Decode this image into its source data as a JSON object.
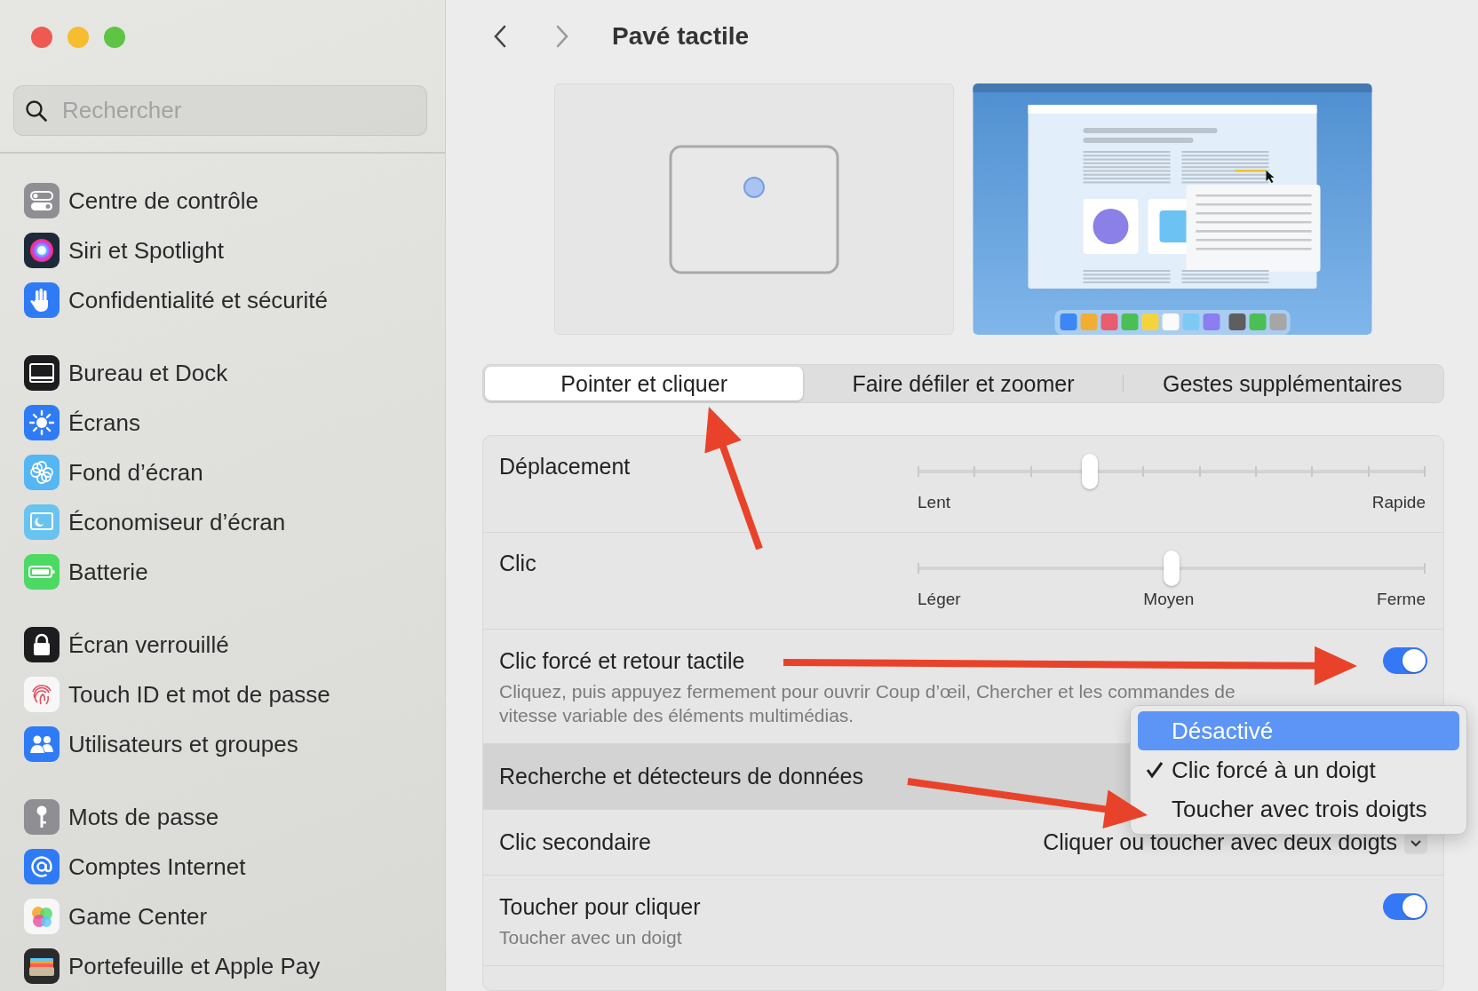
{
  "window": {
    "title": "Pavé tactile"
  },
  "sidebar": {
    "search": {
      "placeholder": "Rechercher"
    },
    "groups": [
      {
        "items": [
          {
            "kind": "controls",
            "label": "Centre de contrôle"
          },
          {
            "kind": "siri",
            "label": "Siri et Spotlight"
          },
          {
            "kind": "privacy",
            "label": "Confidentialité et sécurité"
          }
        ]
      },
      {
        "items": [
          {
            "kind": "dock",
            "label": "Bureau et Dock"
          },
          {
            "kind": "displays",
            "label": "Écrans"
          },
          {
            "kind": "wallpaper",
            "label": "Fond d’écran"
          },
          {
            "kind": "screensaver",
            "label": "Économiseur d’écran"
          },
          {
            "kind": "battery",
            "label": "Batterie"
          }
        ]
      },
      {
        "items": [
          {
            "kind": "lock",
            "label": "Écran verrouillé"
          },
          {
            "kind": "touchid",
            "label": "Touch ID et mot de passe"
          },
          {
            "kind": "users",
            "label": "Utilisateurs et groupes"
          }
        ]
      },
      {
        "items": [
          {
            "kind": "passwords",
            "label": "Mots de passe"
          },
          {
            "kind": "internet",
            "label": "Comptes Internet"
          },
          {
            "kind": "gamecenter",
            "label": "Game Center"
          },
          {
            "kind": "wallet",
            "label": "Portefeuille et Apple Pay"
          }
        ]
      }
    ]
  },
  "tabs": [
    {
      "label": "Pointer et cliquer",
      "selected": true
    },
    {
      "label": "Faire défiler et zoomer",
      "selected": false
    },
    {
      "label": "Gestes supplémentaires",
      "selected": false
    }
  ],
  "rows": [
    {
      "kind": "slider",
      "label": "Déplacement",
      "level": 0.34,
      "scale_labels": [
        "Lent",
        "Rapide"
      ],
      "selected": false
    },
    {
      "kind": "slider",
      "label": "Clic",
      "level": 0.5,
      "scale_labels": [
        "Léger",
        "Moyen",
        "Ferme"
      ],
      "selected": false
    },
    {
      "kind": "toggle",
      "label": "Clic forcé et retour tactile",
      "description": "Cliquez, puis appuyez fermement pour ouvrir Coup d’œil, Chercher et les commandes de vitesse variable des éléments multimédias.",
      "on": true,
      "selected": false
    },
    {
      "kind": "popup",
      "label": "Recherche et détecteurs de données",
      "selected": true
    },
    {
      "kind": "popup",
      "label": "Clic secondaire",
      "value": "Cliquer ou toucher avec deux doigts",
      "selected": false
    },
    {
      "kind": "toggle",
      "label": "Toucher pour cliquer",
      "description": "Toucher avec un doigt",
      "on": true,
      "selected": false
    }
  ],
  "menu": {
    "items": [
      {
        "label": "Désactivé",
        "checked": false,
        "selected": true
      },
      {
        "label": "Clic forcé à un doigt",
        "checked": true,
        "selected": false
      },
      {
        "label": "Toucher avec trois doigts",
        "checked": false,
        "selected": false
      }
    ]
  }
}
